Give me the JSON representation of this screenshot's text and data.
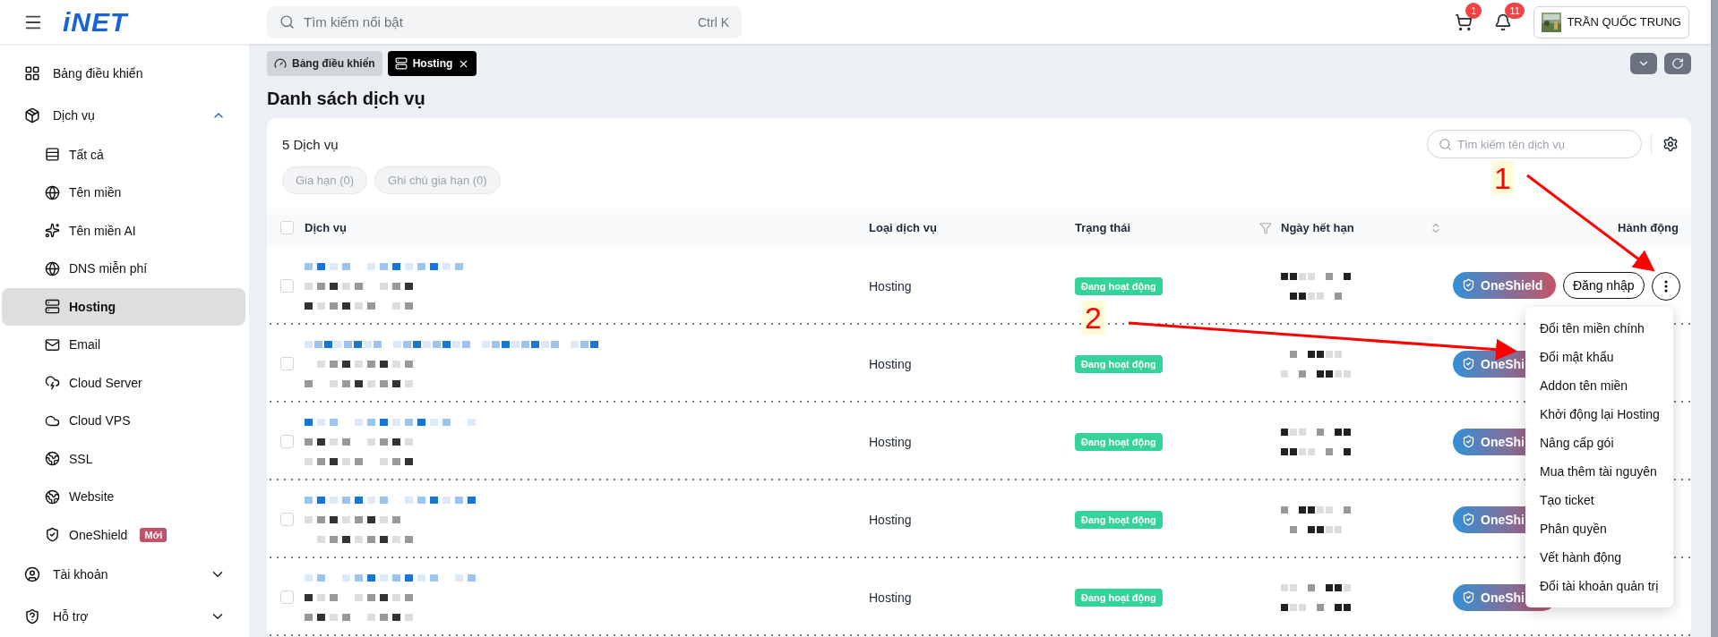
{
  "topbar": {
    "logo": "iNET",
    "search": {
      "placeholder": "Tìm kiếm nổi bật",
      "shortcut": "Ctrl K"
    },
    "cart_count": "1",
    "notification_count": "11",
    "user": "TRẦN QUỐC TRUNG"
  },
  "sidebar": {
    "items": [
      {
        "label": "Bảng điều khiển",
        "selected": false
      },
      {
        "label": "Dịch vụ",
        "selected": false,
        "expanded": true,
        "children": [
          {
            "label": "Tất cả",
            "selected": false
          },
          {
            "label": "Tên miền",
            "selected": false
          },
          {
            "label": "Tên miền AI",
            "selected": false
          },
          {
            "label": "DNS miễn phí",
            "selected": false
          },
          {
            "label": "Hosting",
            "selected": true
          },
          {
            "label": "Email",
            "selected": false
          },
          {
            "label": "Cloud Server",
            "selected": false
          },
          {
            "label": "Cloud VPS",
            "selected": false
          },
          {
            "label": "SSL",
            "selected": false
          },
          {
            "label": "Website",
            "selected": false
          },
          {
            "label": "OneShield",
            "selected": false,
            "badge": "Mới"
          }
        ]
      },
      {
        "label": "Tài khoản",
        "selected": false,
        "expanded": false
      },
      {
        "label": "Hỗ trợ",
        "selected": false,
        "expanded": false
      }
    ]
  },
  "tabs": [
    {
      "label": "Bảng điều khiển",
      "selected": false,
      "closable": false
    },
    {
      "label": "Hosting",
      "selected": true,
      "closable": true
    }
  ],
  "page_title": "Danh sách dịch vụ",
  "card": {
    "count": "5 Dịch vụ",
    "search": {
      "placeholder": "Tìm kiếm tên dịch vụ"
    },
    "filters": [
      {
        "label": "Gia hạn (0)",
        "disabled": true
      },
      {
        "label": "Ghi chú gia hạn (0)",
        "disabled": true
      }
    ]
  },
  "table": {
    "header_checked": false,
    "columns": [
      "Dịch vụ",
      "Loại dịch vụ",
      "Trạng thái",
      "Ngày hết hạn",
      "Hành động"
    ],
    "rows": [
      {
        "checked": false,
        "type": "Hosting",
        "status": "Đang hoạt động",
        "actions": [
          {
            "kind": "oneshield",
            "label": "OneShield"
          },
          {
            "kind": "login",
            "label": "Đăng nhập"
          },
          {
            "kind": "more"
          }
        ]
      },
      {
        "checked": false,
        "type": "Hosting",
        "status": "Đang hoạt động",
        "actions": [
          {
            "kind": "oneshield",
            "label": "OneShi"
          }
        ]
      },
      {
        "checked": false,
        "type": "Hosting",
        "status": "Đang hoạt động",
        "actions": [
          {
            "kind": "oneshield",
            "label": "OneShi"
          }
        ]
      },
      {
        "checked": false,
        "type": "Hosting",
        "status": "Đang hoạt động",
        "actions": [
          {
            "kind": "oneshield",
            "label": "OneShi"
          }
        ]
      },
      {
        "checked": false,
        "type": "Hosting",
        "status": "Đang hoạt động",
        "actions": [
          {
            "kind": "oneshield",
            "label": "OneShi"
          }
        ]
      }
    ]
  },
  "action_menu": [
    "Đổi tên miền chính",
    "Đổi mật khẩu",
    "Addon tên miền",
    "Khởi động lại Hosting",
    "Nâng cấp gói",
    "Mua thêm tài nguyên",
    "Tạo ticket",
    "Phân quyền",
    "Vết hành động",
    "Đổi tài khoản quản trị"
  ],
  "annotations": [
    {
      "label": "1"
    },
    {
      "label": "2"
    }
  ]
}
